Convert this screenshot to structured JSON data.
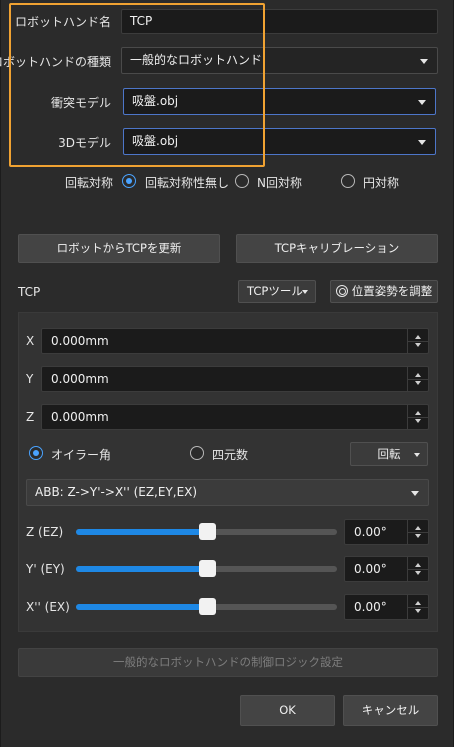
{
  "robot_hand": {
    "name_label": "ロボットハンド名",
    "name_value": "TCP",
    "type_label": "ロボットハンドの種類",
    "type_value": "一般的なロボットハンド",
    "collision_label": "衝突モデル",
    "collision_value": "吸盤.obj",
    "model3d_label": "3Dモデル",
    "model3d_value": "吸盤.obj"
  },
  "symmetry": {
    "label": "回転対称",
    "options": [
      "回転対称性無し",
      "N回対称",
      "円対称"
    ],
    "selected": "回転対称性無し"
  },
  "actions": {
    "update_tcp_label": "ロボットからTCPを更新",
    "tcp_calibration_label": "TCPキャリブレーション"
  },
  "tcp": {
    "section_label": "TCP",
    "tool_select": "TCPツール",
    "adjust_pose_label": "位置姿勢を調整",
    "x_label": "X",
    "x_value": "0.000mm",
    "y_label": "Y",
    "y_value": "0.000mm",
    "z_label": "Z",
    "z_value": "0.000mm",
    "rotation_modes": [
      "オイラー角",
      "四元数"
    ],
    "rotation_selected": "オイラー角",
    "rotation_dropdown": "回転",
    "euler_convention": "ABB: Z->Y'->X'' (EZ,EY,EX)",
    "angles": [
      {
        "label": "Z (EZ)",
        "value": "0.00°",
        "slider_fraction": 0.5
      },
      {
        "label": "Y' (EY)",
        "value": "0.00°",
        "slider_fraction": 0.5
      },
      {
        "label": "X'' (EX)",
        "value": "0.00°",
        "slider_fraction": 0.5
      }
    ]
  },
  "footer": {
    "control_logic_label": "一般的なロボットハンドの制御ロジック設定",
    "ok_label": "OK",
    "cancel_label": "キャンセル"
  },
  "colors": {
    "accent": "#1e88e5",
    "highlight": "#f0a232",
    "focus": "#4d76c9"
  }
}
